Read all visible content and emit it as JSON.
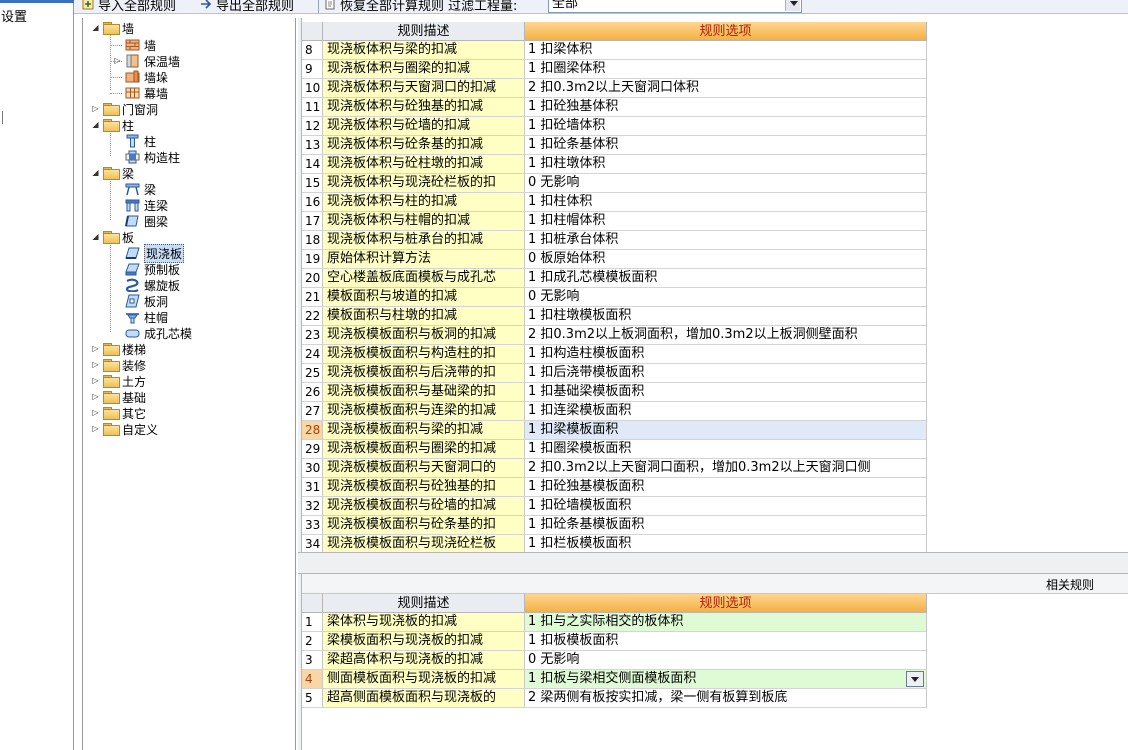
{
  "left_panel": {
    "label": "设置"
  },
  "toolbar": {
    "import_label": "导入全部规则",
    "export_label": "导出全部规则",
    "restore_label": "恢复全部计算规则",
    "filter_label": "过滤工程量:",
    "filter_value": "全部"
  },
  "tree": {
    "wall": {
      "label": "墙",
      "children": [
        "墙",
        "保温墙",
        "墙垛",
        "幕墙"
      ]
    },
    "door_window": {
      "label": "门窗洞"
    },
    "column": {
      "label": "柱",
      "children": [
        "柱",
        "构造柱"
      ]
    },
    "beam": {
      "label": "梁",
      "children": [
        "梁",
        "连梁",
        "圈梁"
      ]
    },
    "slab": {
      "label": "板",
      "children": [
        "现浇板",
        "预制板",
        "螺旋板",
        "板洞",
        "柱帽",
        "成孔芯模"
      ]
    },
    "stair": {
      "label": "楼梯"
    },
    "decoration": {
      "label": "装修"
    },
    "earthwork": {
      "label": "土方"
    },
    "foundation": {
      "label": "基础"
    },
    "other": {
      "label": "其它"
    },
    "custom": {
      "label": "自定义"
    }
  },
  "upper_grid": {
    "headers": {
      "desc": "规则描述",
      "option": "规则选项"
    },
    "current_row": "28",
    "rows": [
      {
        "n": "8",
        "desc": "现浇板体积与梁的扣减",
        "opt": "1   扣梁体积"
      },
      {
        "n": "9",
        "desc": "现浇板体积与圈梁的扣减",
        "opt": "1   扣圈梁体积"
      },
      {
        "n": "10",
        "desc": "现浇板体积与天窗洞口的扣减",
        "opt": "2   扣0.3m2以上天窗洞口体积"
      },
      {
        "n": "11",
        "desc": "现浇板体积与砼独基的扣减",
        "opt": "1   扣砼独基体积"
      },
      {
        "n": "12",
        "desc": "现浇板体积与砼墙的扣减",
        "opt": "1   扣砼墙体积"
      },
      {
        "n": "13",
        "desc": "现浇板体积与砼条基的扣减",
        "opt": "1   扣砼条基体积"
      },
      {
        "n": "14",
        "desc": "现浇板体积与砼柱墩的扣减",
        "opt": "1   扣柱墩体积"
      },
      {
        "n": "15",
        "desc": "现浇板体积与现浇砼栏板的扣",
        "opt": "0   无影响"
      },
      {
        "n": "16",
        "desc": "现浇板体积与柱的扣减",
        "opt": "1   扣柱体积"
      },
      {
        "n": "17",
        "desc": "现浇板体积与柱帽的扣减",
        "opt": "1   扣柱帽体积"
      },
      {
        "n": "18",
        "desc": "现浇板体积与桩承台的扣减",
        "opt": "1   扣桩承台体积"
      },
      {
        "n": "19",
        "desc": "原始体积计算方法",
        "opt": "0  板原始体积"
      },
      {
        "n": "20",
        "desc": "空心楼盖板底面模板与成孔芯",
        "opt": "1  扣成孔芯模模板面积"
      },
      {
        "n": "21",
        "desc": "模板面积与坡道的扣减",
        "opt": "0   无影响"
      },
      {
        "n": "22",
        "desc": "模板面积与柱墩的扣减",
        "opt": "1   扣柱墩模板面积"
      },
      {
        "n": "23",
        "desc": "现浇板模板面积与板洞的扣减",
        "opt": "2   扣0.3m2以上板洞面积，增加0.3m2以上板洞侧壁面积"
      },
      {
        "n": "24",
        "desc": "现浇板模板面积与构造柱的扣",
        "opt": "1   扣构造柱模板面积"
      },
      {
        "n": "25",
        "desc": "现浇板模板面积与后浇带的扣",
        "opt": "1   扣后浇带模板面积"
      },
      {
        "n": "26",
        "desc": "现浇板模板面积与基础梁的扣",
        "opt": "1   扣基础梁模板面积"
      },
      {
        "n": "27",
        "desc": "现浇板模板面积与连梁的扣减",
        "opt": "1   扣连梁模板面积"
      },
      {
        "n": "28",
        "desc": "现浇板模板面积与梁的扣减",
        "opt": "1   扣梁模板面积"
      },
      {
        "n": "29",
        "desc": "现浇板模板面积与圈梁的扣减",
        "opt": "1   扣圈梁模板面积"
      },
      {
        "n": "30",
        "desc": "现浇板模板面积与天窗洞口的",
        "opt": "2   扣0.3m2以上天窗洞口面积，增加0.3m2以上天窗洞口侧"
      },
      {
        "n": "31",
        "desc": "现浇板模板面积与砼独基的扣",
        "opt": "1   扣砼独基模板面积"
      },
      {
        "n": "32",
        "desc": "现浇板模板面积与砼墙的扣减",
        "opt": "1   扣砼墙模板面积"
      },
      {
        "n": "33",
        "desc": "现浇板模板面积与砼条基的扣",
        "opt": "1   扣砼条基模板面积"
      },
      {
        "n": "34",
        "desc": "现浇板模板面积与现浇砼栏板",
        "opt": "1   扣栏板模板面积"
      }
    ]
  },
  "related_rules": {
    "label": "相关规则"
  },
  "lower_grid": {
    "headers": {
      "desc": "规则描述",
      "option": "规则选项"
    },
    "current_row": "4",
    "rows": [
      {
        "n": "1",
        "desc": "梁体积与现浇板的扣减",
        "opt": "1  扣与之实际相交的板体积"
      },
      {
        "n": "2",
        "desc": "梁模板面积与现浇板的扣减",
        "opt": "1  扣板模板面积"
      },
      {
        "n": "3",
        "desc": "梁超高体积与现浇板的扣减",
        "opt": "0   无影响"
      },
      {
        "n": "4",
        "desc": "侧面模板面积与现浇板的扣减",
        "opt": "1  扣板与梁相交侧面模板面积"
      },
      {
        "n": "5",
        "desc": "超高侧面模板面积与现浇板的",
        "opt": "2  梁两侧有板按实扣减，梁一侧有板算到板底"
      }
    ]
  },
  "colors": {
    "desc_cell_bg": "#ffffc3",
    "option_header_bg": "#f5b142",
    "current_row_bg": "#dfe9f8",
    "lower_option_bg": "#dffbd6"
  }
}
